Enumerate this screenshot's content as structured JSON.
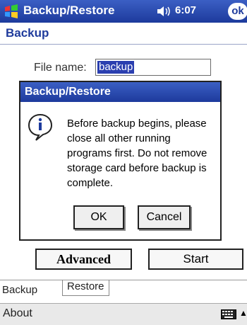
{
  "titlebar": {
    "app_title": "Backup/Restore",
    "time": "6:07",
    "ok_label": "ok",
    "icons": [
      "windows-start-icon",
      "speaker-icon"
    ]
  },
  "page": {
    "title": "Backup",
    "file_label": "File name:",
    "file_value": "backup"
  },
  "dialog": {
    "title": "Backup/Restore",
    "message": "Before backup begins, please close all other running programs first. Do not remove storage card before backup is complete.",
    "ok_label": "OK",
    "cancel_label": "Cancel",
    "icon": "info-icon"
  },
  "actions": {
    "advanced_label": "Advanced",
    "start_label": "Start"
  },
  "tabs": {
    "backup_label": "Backup",
    "restore_label": "Restore"
  },
  "bottombar": {
    "about_label": "About",
    "icons": [
      "keyboard-icon",
      "up-arrow-icon"
    ]
  },
  "colors": {
    "titlebar": "#1d3a9c",
    "accent_text": "#1f3b9c",
    "selection": "#2b3fb0"
  }
}
